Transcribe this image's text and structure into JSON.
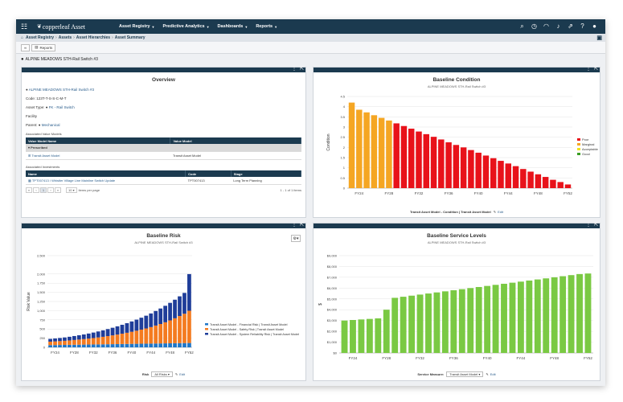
{
  "app": {
    "brand": "copperleaf Asset",
    "nav": [
      "Asset Registry",
      "Predictive Analytics",
      "Dashboards",
      "Reports"
    ],
    "breadcrumb": [
      "Asset Registry",
      "Assets",
      "Asset Hierarchies",
      "Asset Summary"
    ],
    "toolbar_reports": "Reports",
    "page_title": "ALPINE MEADOWS STH-Rail Switch #3"
  },
  "overview": {
    "title": "Overview",
    "asset_link": "ALPINE MEADOWS STH-Rail Switch #3",
    "code": "Code: 123T-T-S-S-C-M-T",
    "asset_type_label": "Asset Type:",
    "asset_type_value": "FK - Rail Switch",
    "facility_label": "Facility",
    "parent_label": "Parent:",
    "parent_value": "Mechanical",
    "value_models_title": "Associated Value Models",
    "vm_headers": [
      "Value Model Name",
      "Value Model"
    ],
    "vm_group": "Prescribed",
    "vm_rows": [
      [
        "Transit Asset Model",
        "Transit Asset Model"
      ]
    ],
    "investments_title": "Associated Investments",
    "inv_headers": [
      "Name",
      "Code",
      "Stage"
    ],
    "inv_rows": [
      [
        "TPT007413 / Whistler Village Line Mainline Switch Update",
        "TPT007413",
        "Long Term Planning"
      ]
    ],
    "page_size": "10",
    "items_per_page": "items per page",
    "page_num": "1",
    "count_text": "1 - 1 of 1 items"
  },
  "condition_panel": {
    "title": "Baseline Condition",
    "subtitle": "ALPINE MEADOWS STH-Rail Switch #3",
    "footer": "Transit Asset Model - Condition | Transit Asset Model",
    "edit": "Edit",
    "legend": [
      "Poor",
      "Marginal",
      "Acceptable",
      "Good"
    ]
  },
  "risk_panel": {
    "title": "Baseline Risk",
    "subtitle": "ALPINE MEADOWS STH-Rail Switch #3",
    "risk_label": "Risk",
    "risk_select": "All Risks",
    "edit": "Edit"
  },
  "service_panel": {
    "title": "Baseline Service Levels",
    "subtitle": "ALPINE MEADOWS STH-Rail Switch #3",
    "measure_label": "Service Measure:",
    "measure_select": "Transit Asset Model",
    "edit": "Edit"
  },
  "colors": {
    "navy": "#1b3a4f",
    "poor": "#e8121a",
    "marginal": "#f5a623",
    "acceptable": "#f1e21f",
    "good": "#3a9d23",
    "risk_financial": "#1f77c9",
    "risk_safety": "#f47b20",
    "risk_reliability": "#1f3d99",
    "service": "#7ac943"
  },
  "chart_data": [
    {
      "type": "bar",
      "title": "Baseline Condition",
      "ylabel": "Condition",
      "xlabel": "",
      "x_ticks": [
        "FY24",
        "FY28",
        "FY32",
        "FY36",
        "FY40",
        "FY44",
        "FY48",
        "FY52"
      ],
      "yticks": [
        "0",
        "0.5",
        "1",
        "1.5",
        "2",
        "2.5",
        "3",
        "3.5",
        "4",
        "4.5"
      ],
      "ylim": [
        0,
        4.5
      ],
      "legend_position": "right",
      "x": [
        "FY23",
        "FY24",
        "FY25",
        "FY26",
        "FY27",
        "FY28",
        "FY29",
        "FY30",
        "FY31",
        "FY32",
        "FY33",
        "FY34",
        "FY35",
        "FY36",
        "FY37",
        "FY38",
        "FY39",
        "FY40",
        "FY41",
        "FY42",
        "FY43",
        "FY44",
        "FY45",
        "FY46",
        "FY47",
        "FY48",
        "FY49",
        "FY50",
        "FY51",
        "FY52"
      ],
      "values": [
        4.2,
        3.85,
        3.72,
        3.58,
        3.45,
        3.32,
        3.18,
        3.05,
        2.92,
        2.78,
        2.65,
        2.52,
        2.39,
        2.25,
        2.12,
        2.0,
        1.87,
        1.74,
        1.6,
        1.47,
        1.34,
        1.21,
        1.08,
        0.94,
        0.81,
        0.68,
        0.55,
        0.41,
        0.3,
        0.18
      ],
      "categories_by_bar": [
        "Marginal",
        "Marginal",
        "Marginal",
        "Marginal",
        "Marginal",
        "Marginal",
        "Poor",
        "Poor",
        "Poor",
        "Poor",
        "Poor",
        "Poor",
        "Poor",
        "Poor",
        "Poor",
        "Poor",
        "Poor",
        "Poor",
        "Poor",
        "Poor",
        "Poor",
        "Poor",
        "Poor",
        "Poor",
        "Poor",
        "Poor",
        "Poor",
        "Poor",
        "Poor",
        "Poor"
      ]
    },
    {
      "type": "bar",
      "stacked": true,
      "title": "Baseline Risk",
      "ylabel": "Risk Value",
      "x_ticks": [
        "FY24",
        "FY28",
        "FY32",
        "FY36",
        "FY40",
        "FY44",
        "FY48",
        "FY52"
      ],
      "yticks": [
        "0",
        "250",
        "500",
        "750",
        "1,000",
        "1,250",
        "1,500",
        "1,750",
        "2,000",
        "2,500"
      ],
      "ylim": [
        0,
        2500
      ],
      "legend_position": "right",
      "categories": [
        "FY23",
        "FY24",
        "FY25",
        "FY26",
        "FY27",
        "FY28",
        "FY29",
        "FY30",
        "FY31",
        "FY32",
        "FY33",
        "FY34",
        "FY35",
        "FY36",
        "FY37",
        "FY38",
        "FY39",
        "FY40",
        "FY41",
        "FY42",
        "FY43",
        "FY44",
        "FY45",
        "FY46",
        "FY47",
        "FY48",
        "FY49",
        "FY50",
        "FY51",
        "FY52"
      ],
      "series": [
        {
          "name": "Transit Asset Model - Financial Risk | Transit Asset Model",
          "values": [
            60,
            62,
            64,
            66,
            68,
            70,
            72,
            74,
            76,
            78,
            80,
            82,
            84,
            86,
            88,
            90,
            92,
            94,
            96,
            98,
            100,
            102,
            104,
            106,
            108,
            110,
            112,
            114,
            116,
            118
          ]
        },
        {
          "name": "Transit Asset Model - Safety Risk | Transit Asset Model",
          "values": [
            95,
            100,
            105,
            112,
            120,
            130,
            140,
            150,
            162,
            175,
            190,
            205,
            222,
            240,
            260,
            282,
            305,
            330,
            357,
            385,
            415,
            450,
            490,
            530,
            575,
            625,
            680,
            740,
            800,
            880
          ]
        },
        {
          "name": "Transit Asset Model - System Reliability Risk | Transit Asset Model",
          "values": [
            75,
            80,
            86,
            92,
            100,
            108,
            117,
            127,
            138,
            150,
            163,
            177,
            192,
            208,
            225,
            243,
            262,
            282,
            303,
            325,
            348,
            372,
            397,
            423,
            450,
            478,
            507,
            537,
            568,
            1000
          ]
        }
      ]
    },
    {
      "type": "bar",
      "title": "Baseline Service Levels",
      "ylabel": "$",
      "x_ticks": [
        "FY24",
        "FY28",
        "FY32",
        "FY36",
        "FY40",
        "FY44",
        "FY48",
        "FY52"
      ],
      "yticks": [
        "$0",
        "$1,000",
        "$2,000",
        "$3,000",
        "$4,000",
        "$5,000",
        "$6,000",
        "$7,000",
        "$8,000",
        "$9,000"
      ],
      "ylim": [
        0,
        9000
      ],
      "x": [
        "FY23",
        "FY24",
        "FY25",
        "FY26",
        "FY27",
        "FY28",
        "FY29",
        "FY30",
        "FY31",
        "FY32",
        "FY33",
        "FY34",
        "FY35",
        "FY36",
        "FY37",
        "FY38",
        "FY39",
        "FY40",
        "FY41",
        "FY42",
        "FY43",
        "FY44",
        "FY45",
        "FY46",
        "FY47",
        "FY48",
        "FY49",
        "FY50",
        "FY51",
        "FY52"
      ],
      "values": [
        3000,
        3050,
        3100,
        3150,
        3200,
        4000,
        5100,
        5200,
        5300,
        5400,
        5500,
        5600,
        5700,
        5800,
        5900,
        6000,
        6100,
        6200,
        6300,
        6400,
        6500,
        6600,
        6700,
        6800,
        6900,
        7000,
        7100,
        7200,
        7300,
        7350
      ]
    }
  ]
}
